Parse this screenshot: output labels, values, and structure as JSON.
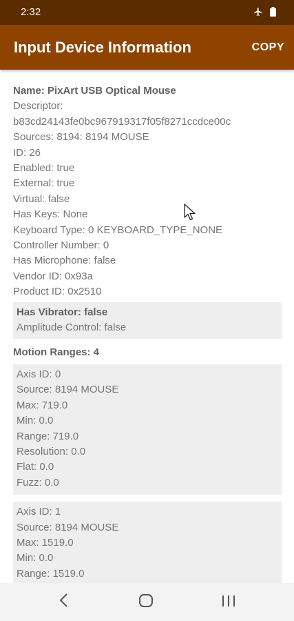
{
  "status_bar": {
    "time": "2:32",
    "icons": [
      "airplane-icon",
      "battery-icon"
    ]
  },
  "app_bar": {
    "title": "Input Device Information",
    "copy_label": "COPY"
  },
  "device": {
    "name": "Name: PixArt USB Optical Mouse",
    "descriptor_label": "Descriptor:",
    "descriptor_value": "b83cd24143fe0bc967919317f05f8271ccdce00c",
    "sources": "Sources: 8194: 8194 MOUSE",
    "id": "ID: 26",
    "enabled": "Enabled: true",
    "external": "External: true",
    "virtual": "Virtual: false",
    "has_keys": "Has Keys: None",
    "keyboard_type": "Keyboard Type: 0 KEYBOARD_TYPE_NONE",
    "controller_number": "Controller Number: 0",
    "has_microphone": "Has Microphone: false",
    "vendor_id": "Vendor ID: 0x93a",
    "product_id": "Product ID: 0x2510"
  },
  "vibrator": {
    "has_vibrator": "Has Vibrator: false",
    "amplitude_control": "Amplitude Control: false"
  },
  "motion_ranges_title": "Motion Ranges: 4",
  "motion_ranges": [
    {
      "axis_id": "Axis ID: 0",
      "source": "Source: 8194 MOUSE",
      "max": "Max: 719.0",
      "min": "Min: 0.0",
      "range": "Range: 719.0",
      "resolution": "Resolution: 0.0",
      "flat": "Flat: 0.0",
      "fuzz": "Fuzz: 0.0"
    },
    {
      "axis_id": "Axis ID: 1",
      "source": "Source: 8194 MOUSE",
      "max": "Max: 1519.0",
      "min": "Min: 0.0",
      "range": "Range: 1519.0"
    }
  ],
  "colors": {
    "status_bar": "#5a2c00",
    "app_bar": "#8f4300",
    "block": "#eeeeee",
    "text": "#757575"
  }
}
